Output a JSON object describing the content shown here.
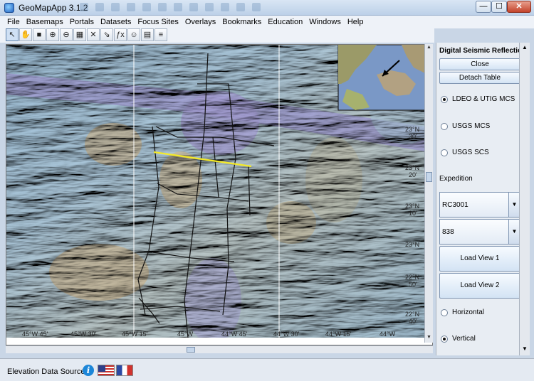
{
  "window": {
    "title": "GeoMapApp 3.1.2",
    "min_label": "—",
    "max_label": "☐",
    "close_label": "✕"
  },
  "menu": [
    "File",
    "Basemaps",
    "Portals",
    "Datasets",
    "Focus Sites",
    "Overlays",
    "Bookmarks",
    "Education",
    "Windows",
    "Help"
  ],
  "toolbar": {
    "tools": [
      {
        "name": "select-arrow-icon",
        "glyph": "↖"
      },
      {
        "name": "pan-hand-icon",
        "glyph": "✋"
      },
      {
        "name": "save-icon",
        "glyph": "■"
      },
      {
        "name": "zoom-in-icon",
        "glyph": "⊕"
      },
      {
        "name": "zoom-out-icon",
        "glyph": "⊖"
      },
      {
        "name": "grid-lines-icon",
        "glyph": "▦"
      },
      {
        "name": "scale-icon",
        "glyph": "✕"
      },
      {
        "name": "profile-icon",
        "glyph": "⇘"
      },
      {
        "name": "function-icon",
        "glyph": "ƒx"
      },
      {
        "name": "layers-icon",
        "glyph": "☺"
      },
      {
        "name": "table-icon",
        "glyph": "▤"
      },
      {
        "name": "list-icon",
        "glyph": "≡"
      }
    ]
  },
  "map": {
    "lat_labels": [
      {
        "deg": "23°N",
        "min": "30'"
      },
      {
        "deg": "23°N",
        "min": "20'"
      },
      {
        "deg": "23°N",
        "min": "10'"
      },
      {
        "deg": "23°N",
        "min": ""
      },
      {
        "deg": "22°N",
        "min": "50'"
      },
      {
        "deg": "22°N",
        "min": "40'"
      }
    ],
    "lon_labels": [
      "45°W 45'",
      "45°W 30'",
      "45°W 15'",
      "45°W",
      "44°W 45'",
      "44°W 30'",
      "44°W 15'",
      "44°W"
    ],
    "colors": {
      "relief_blue": "#8fb3cf",
      "relief_purple": "#a49ed2",
      "relief_tan": "#c6b590",
      "highlight_track": "#f4ea2a",
      "tracks": "#111111"
    }
  },
  "panel": {
    "title": "Digital Seismic Reflectio...",
    "close_label": "Close",
    "detach_label": "Detach Table",
    "sources": [
      {
        "label": "LDEO & UTIG MCS",
        "selected": true
      },
      {
        "label": "USGS MCS",
        "selected": false
      },
      {
        "label": "USGS SCS",
        "selected": false
      }
    ],
    "expedition_label": "Expedition",
    "expedition_value": "RC3001",
    "line_value": "838",
    "load_view1": "Load View 1",
    "load_view2": "Load View 2",
    "orientation": [
      {
        "label": "Horizontal",
        "selected": false
      },
      {
        "label": "Vertical",
        "selected": true
      }
    ]
  },
  "status": {
    "label": "Elevation Data Sources",
    "info_glyph": "i"
  }
}
